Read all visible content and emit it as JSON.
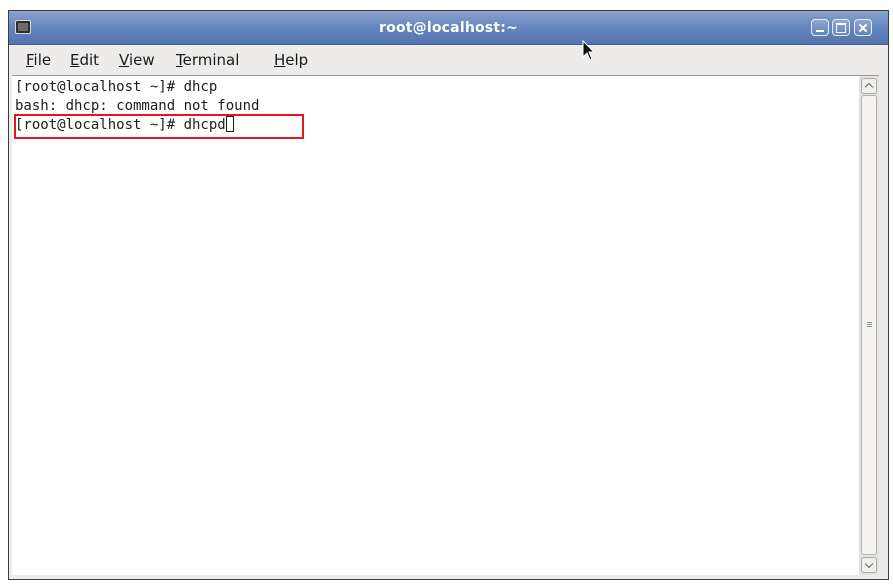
{
  "window": {
    "title": "root@localhost:~"
  },
  "menubar": {
    "items": [
      {
        "mnemonic": "F",
        "rest": "ile"
      },
      {
        "mnemonic": "E",
        "rest": "dit"
      },
      {
        "mnemonic": "V",
        "rest": "iew"
      },
      {
        "mnemonic": "T",
        "rest": "erminal"
      },
      {
        "mnemonic": "H",
        "rest": "elp"
      }
    ]
  },
  "terminal": {
    "lines": [
      "[root@localhost ~]# dhcp",
      "bash: dhcp: command not found",
      "[root@localhost ~]# dhcpd"
    ]
  },
  "icons": {
    "title_icon": "terminal-icon",
    "minimize": "minimize-icon",
    "maximize": "maximize-icon",
    "close": "close-icon",
    "pointer": "mouse-pointer-icon"
  },
  "colors": {
    "titlebar": "#6787bf",
    "highlight": "#e3181e",
    "terminal_bg": "#ffffff",
    "terminal_fg": "#1c1c1c"
  }
}
